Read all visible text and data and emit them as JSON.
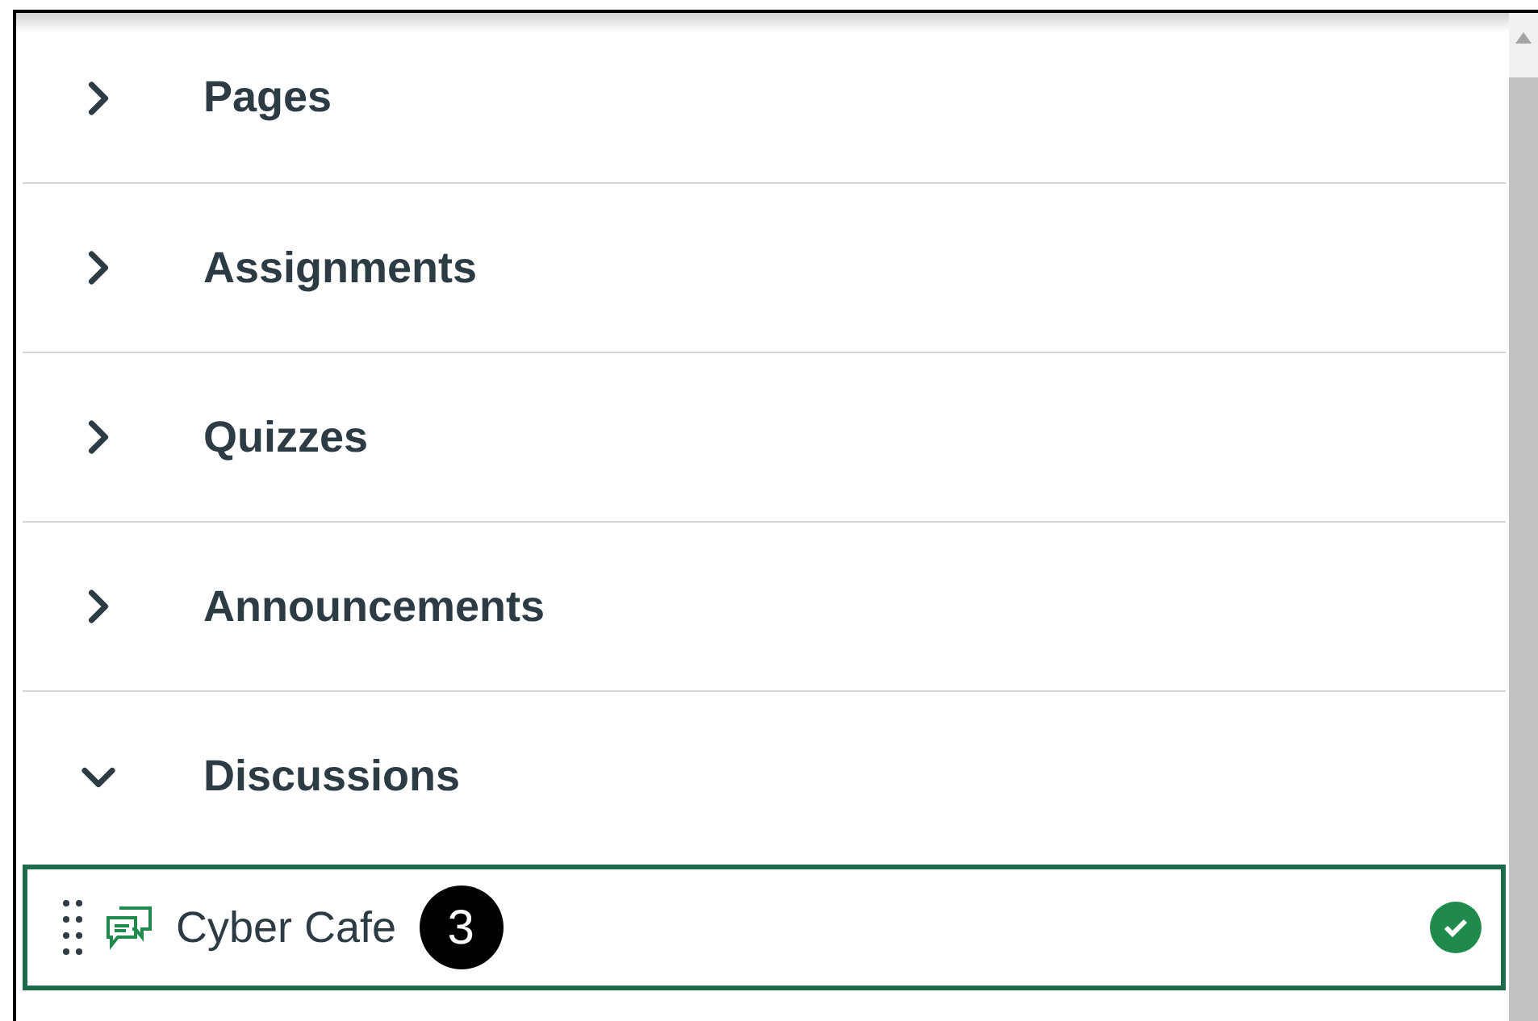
{
  "sections": [
    {
      "title": "Pages",
      "expanded": false
    },
    {
      "title": "Assignments",
      "expanded": false
    },
    {
      "title": "Quizzes",
      "expanded": false
    },
    {
      "title": "Announcements",
      "expanded": false
    },
    {
      "title": "Discussions",
      "expanded": true
    }
  ],
  "items": [
    {
      "title": "Cyber Cafe",
      "published": true,
      "callout": "3"
    }
  ]
}
